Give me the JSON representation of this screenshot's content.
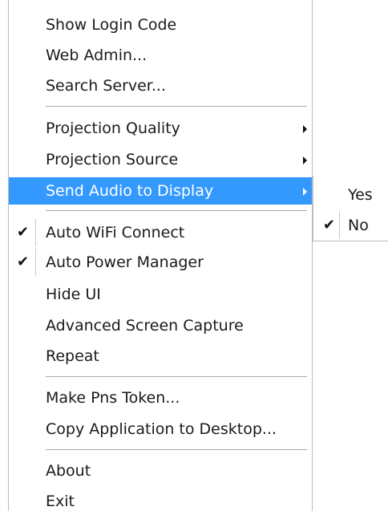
{
  "menu": {
    "items": [
      {
        "label": "Show Login Code"
      },
      {
        "label": "Web Admin..."
      },
      {
        "label": "Search Server..."
      },
      {
        "label": "Projection Quality"
      },
      {
        "label": "Projection Source"
      },
      {
        "label": "Send Audio to Display"
      },
      {
        "label": "Auto WiFi Connect",
        "checked": true
      },
      {
        "label": "Auto Power Manager",
        "checked": true
      },
      {
        "label": "Hide UI"
      },
      {
        "label": "Advanced Screen Capture"
      },
      {
        "label": "Repeat"
      },
      {
        "label": "Make Pns Token..."
      },
      {
        "label": "Copy Application to Desktop..."
      },
      {
        "label": "About"
      },
      {
        "label": "Exit"
      }
    ],
    "check_glyph": "✔"
  },
  "submenu": {
    "items": [
      {
        "label": "Yes"
      },
      {
        "label": "No",
        "checked": true
      }
    ]
  },
  "colors": {
    "highlight": "#3399ff",
    "highlight_text": "#ffffff",
    "text": "#1a1a1a",
    "separator": "#a8a8a8"
  }
}
